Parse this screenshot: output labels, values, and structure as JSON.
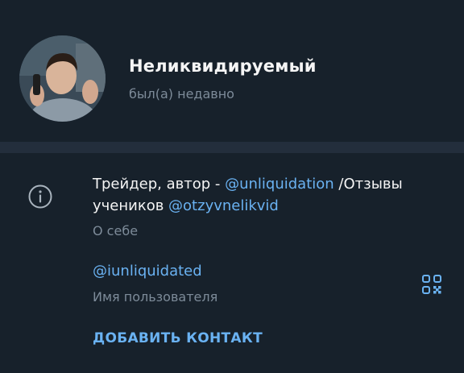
{
  "profile": {
    "name": "Неликвидируемый",
    "status": "был(а) недавно"
  },
  "bio": {
    "text_1": "Трейдер, автор - ",
    "link_1": "@unliquidation",
    "text_2": " /Отзывы учеников ",
    "link_2": "@otzyvnelikvid",
    "caption": "О себе"
  },
  "username": {
    "value": "@iunliquidated",
    "caption": "Имя пользователя"
  },
  "actions": {
    "add_contact": "ДОБАВИТЬ КОНТАКТ"
  },
  "icons": {
    "info": "info-icon",
    "qr": "qr-code-icon"
  },
  "colors": {
    "background": "#17212b",
    "divider": "#232e3c",
    "accent": "#6ab2f2",
    "secondary_text": "#7d8b99"
  }
}
